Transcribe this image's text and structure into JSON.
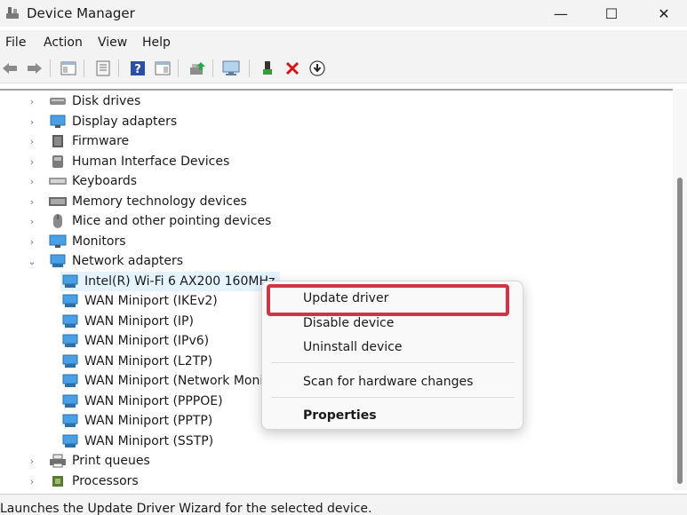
{
  "window": {
    "title": "Device Manager",
    "minimize": "—",
    "maximize": "☐",
    "close": "✕"
  },
  "menu": [
    "File",
    "Action",
    "View",
    "Help"
  ],
  "tree": {
    "categories_top": [
      {
        "label": "Disk drives",
        "icon": "disk-drive-icon"
      },
      {
        "label": "Display adapters",
        "icon": "display-adapter-icon"
      },
      {
        "label": "Firmware",
        "icon": "firmware-icon"
      },
      {
        "label": "Human Interface Devices",
        "icon": "hid-icon"
      },
      {
        "label": "Keyboards",
        "icon": "keyboard-icon"
      },
      {
        "label": "Memory technology devices",
        "icon": "memory-icon"
      },
      {
        "label": "Mice and other pointing devices",
        "icon": "mouse-icon"
      },
      {
        "label": "Monitors",
        "icon": "monitor-icon"
      }
    ],
    "network": {
      "label": "Network adapters",
      "children": [
        "Intel(R) Wi-Fi 6 AX200 160MHz",
        "WAN Miniport (IKEv2)",
        "WAN Miniport (IP)",
        "WAN Miniport (IPv6)",
        "WAN Miniport (L2TP)",
        "WAN Miniport (Network Monitor)",
        "WAN Miniport (PPPOE)",
        "WAN Miniport (PPTP)",
        "WAN Miniport (SSTP)"
      ]
    },
    "categories_bottom": [
      {
        "label": "Print queues",
        "icon": "printer-icon"
      },
      {
        "label": "Processors",
        "icon": "processor-icon"
      }
    ]
  },
  "context_menu": {
    "update_driver": "Update driver",
    "disable_device": "Disable device",
    "uninstall_device": "Uninstall device",
    "scan": "Scan for hardware changes",
    "properties": "Properties"
  },
  "status": "Launches the Update Driver Wizard for the selected device.",
  "colors": {
    "highlight": "#cf3544",
    "accent": "#0067c0"
  }
}
